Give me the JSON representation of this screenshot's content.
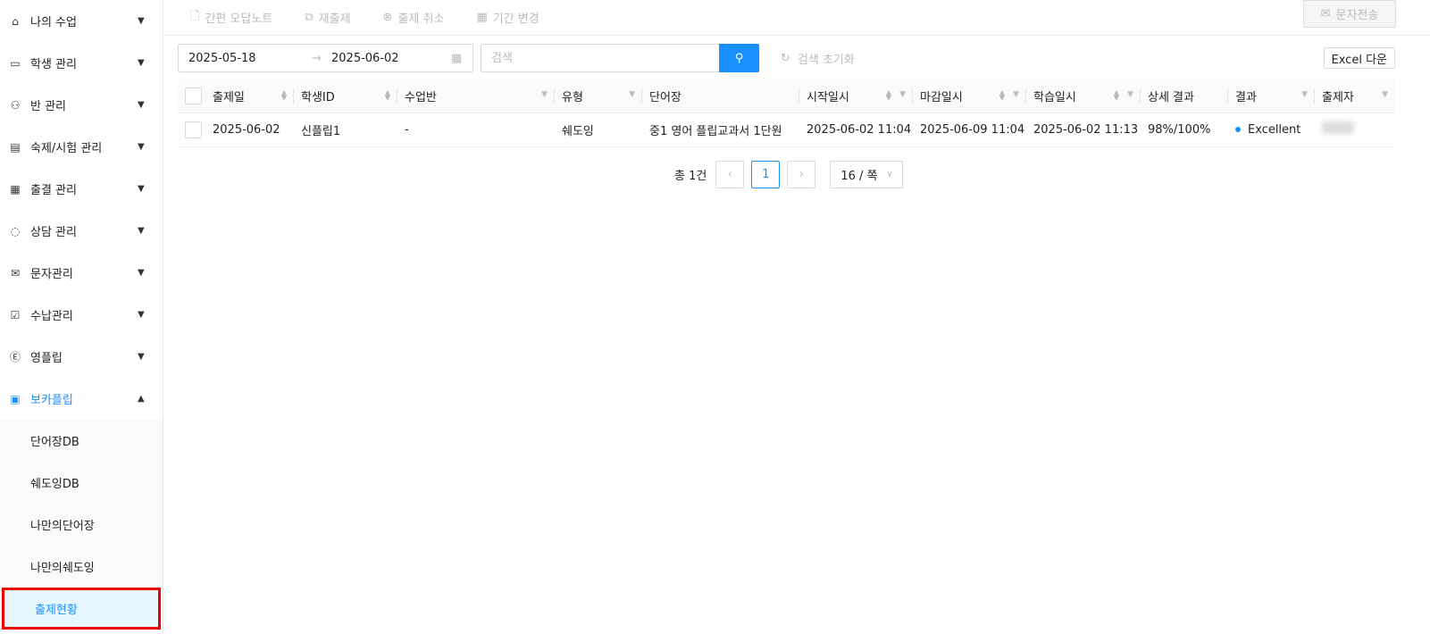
{
  "sidebar": {
    "items": [
      {
        "label": "나의 수업",
        "icon": "home-icon"
      },
      {
        "label": "학생 관리",
        "icon": "id-card-icon"
      },
      {
        "label": "반 관리",
        "icon": "users-icon"
      },
      {
        "label": "숙제/시험 관리",
        "icon": "file-icon"
      },
      {
        "label": "출결 관리",
        "icon": "calendar-icon"
      },
      {
        "label": "상담 관리",
        "icon": "chat-icon"
      },
      {
        "label": "문자관리",
        "icon": "mail-icon"
      },
      {
        "label": "수납관리",
        "icon": "inbox-icon"
      },
      {
        "label": "영플립",
        "icon": "e-icon"
      },
      {
        "label": "보카플립",
        "icon": "v-icon"
      }
    ],
    "sub": [
      "단어장DB",
      "쉐도잉DB",
      "나만의단어장",
      "나만의쉐도잉",
      "출제현황"
    ]
  },
  "toolbar": {
    "note": "간편 오답노트",
    "reissue": "재출제",
    "cancel": "출제 취소",
    "period": "기간 변경",
    "sms": "문자전송"
  },
  "filters": {
    "start": "2025-05-18",
    "end": "2025-06-02",
    "search_placeholder": "검색",
    "reset": "검색 초기화",
    "excel": "Excel 다운"
  },
  "table": {
    "headers": [
      "출제일",
      "학생ID",
      "수업반",
      "유형",
      "단어장",
      "시작일시",
      "마감일시",
      "학습일시",
      "상세 결과",
      "결과",
      "출제자"
    ],
    "rows": [
      {
        "date": "2025-06-02",
        "student": "신플립1",
        "class": "-",
        "type": "쉐도잉",
        "book": "중1 영어 플립교과서 1단원",
        "start": "2025-06-02 11:04",
        "end": "2025-06-09 11:04",
        "study": "2025-06-02 11:13",
        "detail": "98%/100%",
        "result": "Excellent"
      }
    ]
  },
  "pagination": {
    "total": "총 1건",
    "current": "1",
    "size": "16 / 쪽"
  },
  "colors": {
    "accent": "#1890ff",
    "highlight": "#e00000"
  }
}
